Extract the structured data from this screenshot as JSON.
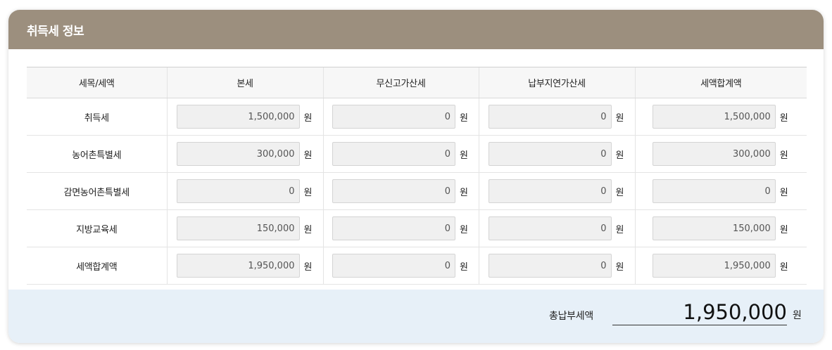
{
  "section": {
    "title": "취득세 정보"
  },
  "table": {
    "headers": [
      "세목/세액",
      "본세",
      "무신고가산세",
      "납부지연가산세",
      "세액합계액"
    ],
    "unit": "원",
    "rows": [
      {
        "label": "취득세",
        "values": [
          "1,500,000",
          "0",
          "0",
          "1,500,000"
        ]
      },
      {
        "label": "농어촌특별세",
        "values": [
          "300,000",
          "0",
          "0",
          "300,000"
        ]
      },
      {
        "label": "감면농어촌특별세",
        "values": [
          "0",
          "0",
          "0",
          "0"
        ]
      },
      {
        "label": "지방교육세",
        "values": [
          "150,000",
          "0",
          "0",
          "150,000"
        ]
      },
      {
        "label": "세액합계액",
        "values": [
          "1,950,000",
          "0",
          "0",
          "1,950,000"
        ]
      }
    ]
  },
  "total": {
    "label": "총납부세액",
    "value": "1,950,000",
    "unit": "원"
  },
  "colors": {
    "header_bg": "#9c8f7e",
    "footer_bg": "#e7f0f8",
    "input_bg": "#f0f0f0"
  }
}
